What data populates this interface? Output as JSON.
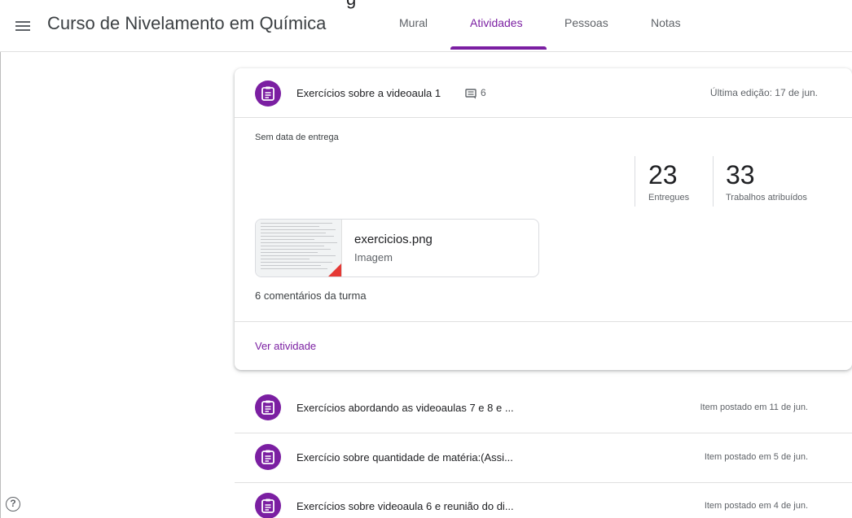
{
  "header": {
    "cutoff_text": "g",
    "course_title": "Curso de Nivelamento em Química",
    "tabs": [
      {
        "label": "Mural"
      },
      {
        "label": "Atividades"
      },
      {
        "label": "Pessoas"
      },
      {
        "label": "Notas"
      }
    ],
    "active_tab": "Atividades"
  },
  "expanded_assignment": {
    "icon": "assignment-icon",
    "title": "Exercícios sobre a videoaula 1",
    "comment_count": "6",
    "last_edit": "Última edição: 17 de jun.",
    "due": "Sem data de entrega",
    "stats": [
      {
        "value": "23",
        "label": "Entregues"
      },
      {
        "value": "33",
        "label": "Trabalhos atribuídos"
      }
    ],
    "attachment": {
      "name": "exercicios.png",
      "type": "Imagem"
    },
    "class_comments": "6 comentários da turma",
    "view_link": "Ver atividade"
  },
  "assignments": [
    {
      "title": "Exercícios abordando as videoaulas 7 e 8 e ...",
      "date": "Item postado em 11 de jun."
    },
    {
      "title": "Exercício sobre quantidade de matéria:(Assi...",
      "date": "Item postado em 5 de jun."
    },
    {
      "title": "Exercícios sobre videoaula 6 e reunião do di...",
      "date": "Item postado em 4 de jun."
    }
  ],
  "colors": {
    "accent": "#7b1fa2",
    "text": "#3c4043",
    "muted": "#5f6368",
    "file_corner": "#e53935"
  }
}
